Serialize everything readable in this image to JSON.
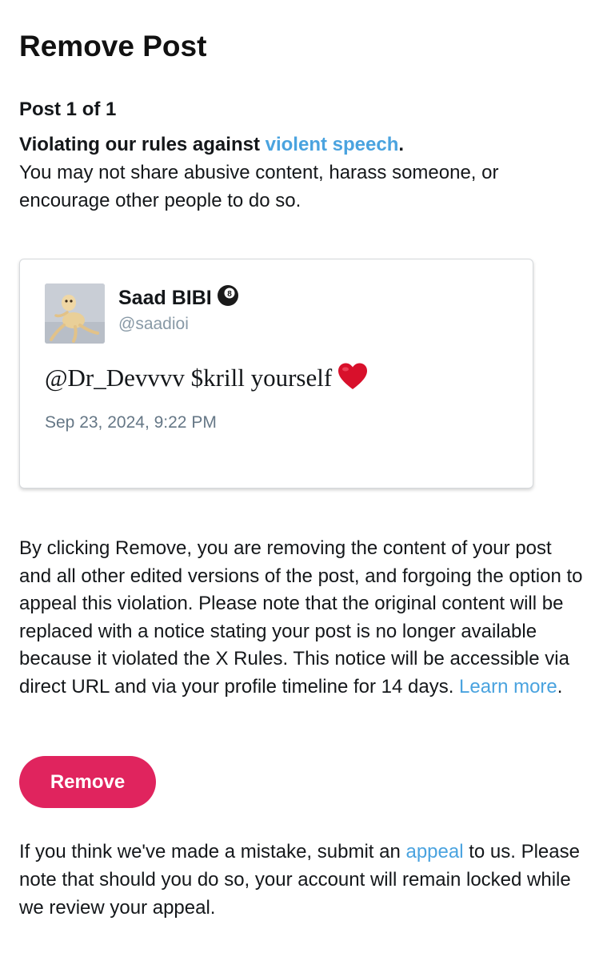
{
  "header": {
    "title": "Remove Post"
  },
  "post_counter": "Post 1 of 1",
  "violation": {
    "lead": "Violating our rules against ",
    "link_text": "violent speech",
    "lead_end": ".",
    "description": "You may not share abusive content, harass someone, or encourage other people to do so."
  },
  "post_card": {
    "author_name": "Saad BIBI",
    "author_badge": "8",
    "handle": "@saadioi",
    "text": "@Dr_Devvvv $krill yourself",
    "timestamp": "Sep 23, 2024, 9:22 PM",
    "avatar_icon": "avatar-photo",
    "emoji_icon": "red-heart-icon"
  },
  "explanation": {
    "text": "By clicking Remove, you are removing the content of your post and all other edited versions of the post, and forgoing the option to appeal this violation. Please note that the original content will be replaced with a notice stating your post is no longer available because it violated the X Rules. This notice will be accessible via direct URL and via your profile timeline for 14 days. ",
    "link_text": "Learn more",
    "end": "."
  },
  "actions": {
    "remove_label": "Remove"
  },
  "appeal": {
    "before": "If you think we've made a mistake, submit an ",
    "link_text": "appeal",
    "after": " to us. Please note that should you do so, your account will remain locked while we review your appeal."
  },
  "colors": {
    "accent_link": "#4aa3df",
    "remove_button": "#e0245e",
    "text": "#14171a",
    "muted": "#657786"
  }
}
